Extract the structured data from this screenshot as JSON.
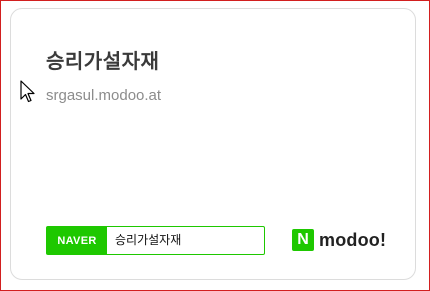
{
  "card": {
    "title": "승리가설자재",
    "url": "srgasul.modoo.at"
  },
  "naver_search": {
    "badge": "NAVER",
    "query": "승리가설자재"
  },
  "modoo_logo": {
    "mark": "N",
    "text": "modoo!"
  },
  "colors": {
    "naver_green": "#1ec800",
    "frame_border": "#d21f1f",
    "title": "#3a3a3a",
    "url": "#8c8c8c"
  },
  "icons": {
    "cursor": "mouse-pointer-icon"
  }
}
